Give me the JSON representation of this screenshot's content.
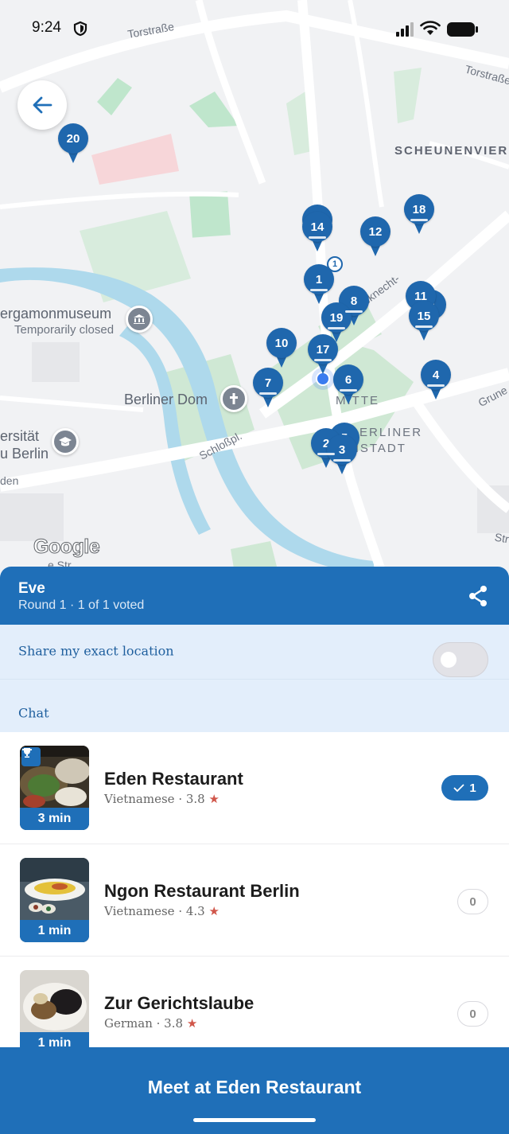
{
  "status_bar": {
    "time": "9:24"
  },
  "map": {
    "streets": {
      "torstrasse_west": "Torstraße",
      "torstrasse_east": "Torstraße",
      "karl_liebknecht": "Karl-Liebknecht-",
      "schlossplatz": "Schloßpl.",
      "gruner": "Grune",
      "str_right": "Str",
      "den": "den",
      "bottom_str": "e Str"
    },
    "districts": {
      "scheunenviertel": "SCHEUNENVIER",
      "mitte": "MITTE",
      "berliner_line1": "BERLINER",
      "berliner_line2": "NSTADT"
    },
    "pois": {
      "pergamon_title": "ergamonmuseum",
      "pergamon_sub": "Temporarily closed",
      "dom_title": "Berliner Dom",
      "uni_line1": "ersität",
      "uni_line2": "u Berlin"
    },
    "pins": [
      "1",
      "2",
      "3",
      "4",
      "5",
      "6",
      "7",
      "8",
      "9",
      "10",
      "11",
      "12",
      "14",
      "15",
      "17",
      "18",
      "19",
      "20"
    ],
    "count_badge": "1",
    "attribution": "Google"
  },
  "sheet": {
    "group_name": "Eve",
    "round_info": "Round 1 · 1 of 1 voted",
    "location_label": "Share my exact location",
    "location_toggle_on": false,
    "chat_label": "Chat"
  },
  "restaurants": [
    {
      "name": "Eden Restaurant",
      "cuisine": "Vietnamese",
      "sep": " · ",
      "rating": "3.8",
      "star": "★",
      "time": "3 min",
      "votes": "1",
      "winner": true
    },
    {
      "name": "Ngon Restaurant Berlin",
      "cuisine": "Vietnamese",
      "sep": " · ",
      "rating": "4.3",
      "star": "★",
      "time": "1 min",
      "votes": "0",
      "winner": false
    },
    {
      "name": "Zur Gerichtslaube",
      "cuisine": "German",
      "sep": " · ",
      "rating": "3.8",
      "star": "★",
      "time": "1 min",
      "votes": "0",
      "winner": false
    }
  ],
  "cta": {
    "label": "Meet at Eden Restaurant"
  },
  "colors": {
    "brand_blue": "#1f6fb8",
    "pin_blue": "#1f67ad",
    "accent_star": "#d0564a"
  }
}
